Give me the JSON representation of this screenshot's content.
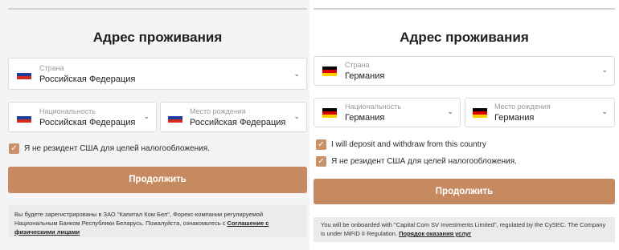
{
  "left": {
    "title": "Адрес проживания",
    "country": {
      "label": "Страна",
      "value": "Российская Федерация"
    },
    "nationality": {
      "label": "Национальность",
      "value": "Российская Федерация"
    },
    "birthplace": {
      "label": "Место рождения",
      "value": "Российская Федерация"
    },
    "checkbox_us": "Я не резидент США для целей налогообложения.",
    "continue": "Продолжить",
    "note_text": "Вы будете зарегистрированы в ЗАО \"Капитал Ком Бел\", Форекс-компании регулируемой Национальным Банком Республики Беларусь. Пожалуйста, ознакомьтесь с",
    "note_link": "Соглашение с физическими лицами"
  },
  "right": {
    "title": "Адрес проживания",
    "country": {
      "label": "Страна",
      "value": "Германия"
    },
    "nationality": {
      "label": "Национальность",
      "value": "Германия"
    },
    "birthplace": {
      "label": "Место рождения",
      "value": "Германия"
    },
    "checkbox_deposit": "I will deposit and withdraw from this country",
    "checkbox_us": "Я не резидент США для целей налогообложения.",
    "continue": "Продолжить",
    "note_text": "You will be onboarded with \"Capital Com SV Investments Limited\", regulated by the CySEC. The Company is under MiFID II Regulation.",
    "note_link": "Порядок оказания услуг"
  },
  "colors": {
    "accent": "#c58a60",
    "russia_flag": [
      "#ffffff",
      "#1c3f9e",
      "#d52b1e"
    ],
    "germany_flag": [
      "#000000",
      "#dd0000",
      "#ffce00"
    ]
  },
  "icons": {
    "dropdown": "chevron-down-icon",
    "checkbox": "check-icon"
  }
}
